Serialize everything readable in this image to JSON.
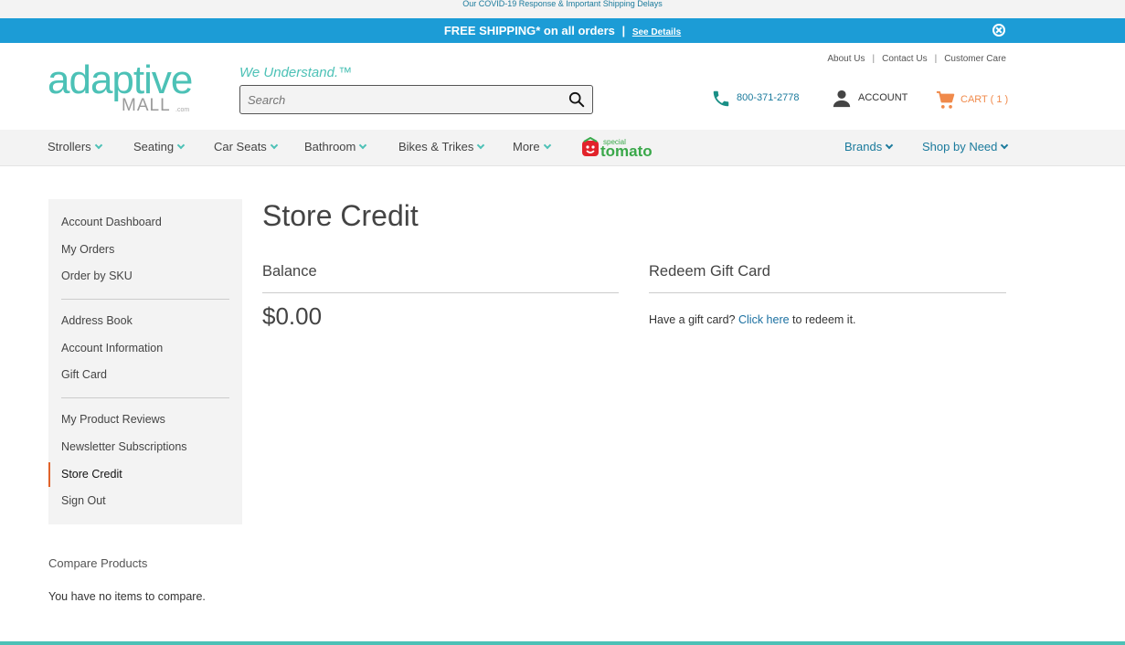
{
  "covid_notice": "Our COVID-19 Response & Important Shipping Delays",
  "shipping_bar": {
    "text": "FREE SHIPPING* on all orders",
    "separator": "|",
    "details_link": "See Details"
  },
  "header": {
    "logo_word": "adaptive",
    "logo_mall": "MALL",
    "logo_com": ".com",
    "tagline": "We Understand.™",
    "search_placeholder": "Search",
    "toplinks": [
      "About Us",
      "Contact Us",
      "Customer Care"
    ],
    "phone": "800-371-2778",
    "account_label": "ACCOUNT",
    "cart_label": "CART ( 1 )"
  },
  "nav": {
    "items": [
      "Strollers",
      "Seating",
      "Car Seats",
      "Bathroom",
      "Bikes & Trikes",
      "More"
    ],
    "brand_logo_small": "special",
    "brand_logo_main": "tomato",
    "right_items": [
      "Brands",
      "Shop by Need"
    ]
  },
  "sidebar": {
    "group1": [
      "Account Dashboard",
      "My Orders",
      "Order by SKU"
    ],
    "group2": [
      "Address Book",
      "Account Information",
      "Gift Card"
    ],
    "group3": [
      "My Product Reviews",
      "Newsletter Subscriptions",
      "Store Credit",
      "Sign Out"
    ]
  },
  "compare": {
    "title": "Compare Products",
    "text": "You have no items to compare."
  },
  "main": {
    "title": "Store Credit",
    "balance_title": "Balance",
    "balance_amount": "$0.00",
    "redeem_title": "Redeem Gift Card",
    "redeem_prefix": "Have a gift card?",
    "redeem_link": "Click here",
    "redeem_suffix": "to redeem it."
  },
  "colors": {
    "brand_teal": "#4cc1b6",
    "ship_bar_blue": "#1c9cd6",
    "link_blue": "#1a7a9c",
    "cart_orange": "#f08a4b",
    "active_marker": "#e0632b"
  }
}
